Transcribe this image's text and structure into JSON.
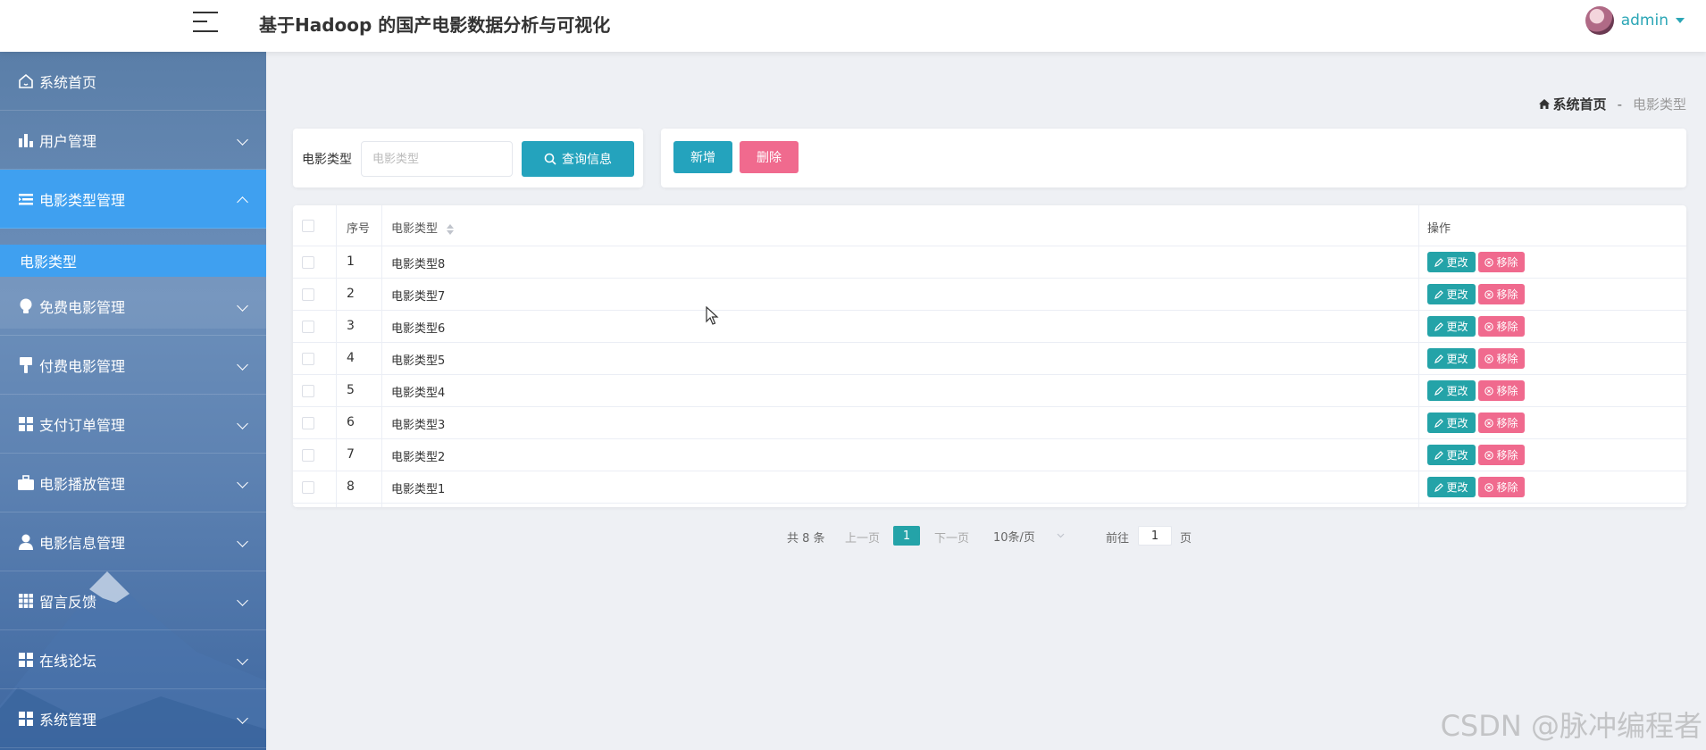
{
  "header": {
    "title": "基于Hadoop 的国产电影数据分析与可视化",
    "user_name": "admin"
  },
  "sidebar": {
    "items": [
      {
        "label": "系统首页",
        "icon": "home-icon"
      },
      {
        "label": "用户管理",
        "icon": "bar-chart-icon"
      },
      {
        "label": "电影类型管理",
        "icon": "list-icon",
        "open": true
      },
      {
        "label": "免费电影管理",
        "icon": "lightbulb-icon"
      },
      {
        "label": "付费电影管理",
        "icon": "brush-icon"
      },
      {
        "label": "支付订单管理",
        "icon": "grid-icon"
      },
      {
        "label": "电影播放管理",
        "icon": "briefcase-icon"
      },
      {
        "label": "电影信息管理",
        "icon": "user-icon"
      },
      {
        "label": "留言反馈",
        "icon": "grid-9-icon"
      },
      {
        "label": "在线论坛",
        "icon": "grid-icon"
      },
      {
        "label": "系统管理",
        "icon": "grid-icon"
      }
    ],
    "submenu": {
      "label": "电影类型"
    }
  },
  "breadcrumb": {
    "home": "系统首页",
    "separator": "-",
    "current": "电影类型"
  },
  "search": {
    "label": "电影类型",
    "placeholder": "电影类型",
    "button_label": "查询信息"
  },
  "actions": {
    "add_label": "新增",
    "delete_label": "删除"
  },
  "table": {
    "columns": [
      "序号",
      "电影类型",
      "操作"
    ],
    "rows": [
      {
        "index": "1",
        "name": "电影类型8"
      },
      {
        "index": "2",
        "name": "电影类型7"
      },
      {
        "index": "3",
        "name": "电影类型6"
      },
      {
        "index": "4",
        "name": "电影类型5"
      },
      {
        "index": "5",
        "name": "电影类型4"
      },
      {
        "index": "6",
        "name": "电影类型3"
      },
      {
        "index": "7",
        "name": "电影类型2"
      },
      {
        "index": "8",
        "name": "电影类型1"
      }
    ],
    "edit_label": "更改",
    "remove_label": "移除"
  },
  "pagination": {
    "total": "共 8 条",
    "prev": "上一页",
    "current_page": "1",
    "next": "下一页",
    "page_size": "10条/页",
    "goto_label": "前往",
    "goto_value": "1",
    "page_suffix": "页"
  },
  "watermark": "CSDN @脉冲编程者",
  "colors": {
    "primary": "#24a3bd",
    "danger": "#f06a8e",
    "menu_active": "#3fa0f0",
    "user_name": "#2ba6b6"
  }
}
